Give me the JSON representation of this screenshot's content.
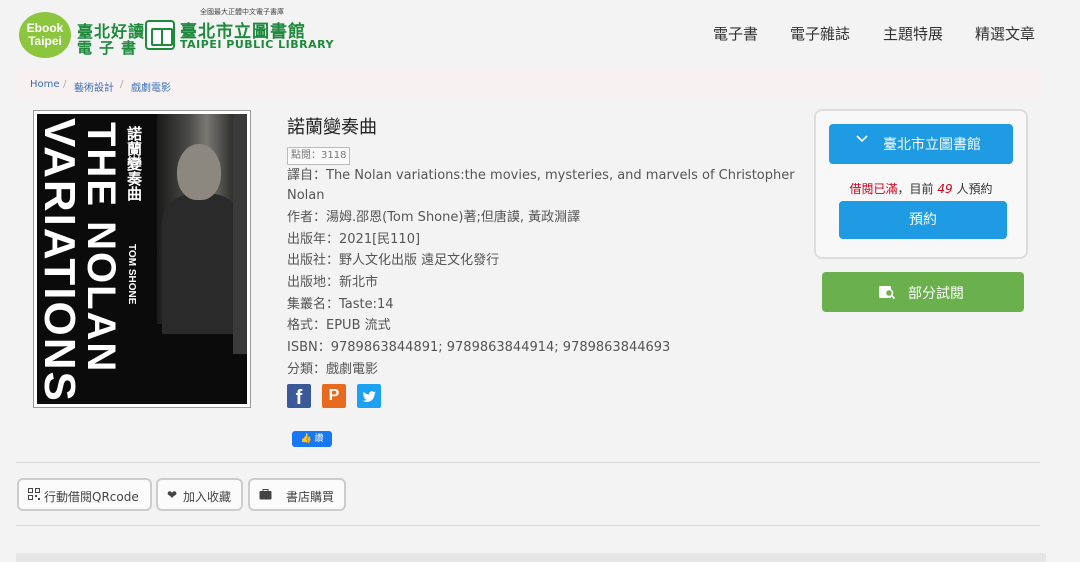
{
  "header": {
    "logo_circle": "Ebook\nTaipei",
    "logo_circle_line1": "Ebook",
    "logo_circle_line2": "Taipei",
    "tagline": "全國最大正體中文電子書庫",
    "brand_line1": "臺北好讀",
    "brand_line2": "電子書",
    "library_name": "臺北市立圖書館",
    "library_en": "TAIPEI PUBLIC LIBRARY",
    "nav": [
      "電子書",
      "電子雜誌",
      "主題特展",
      "精選文章"
    ]
  },
  "breadcrumb": [
    "Home",
    "藝術設計",
    "戲劇電影"
  ],
  "book": {
    "cover_title_a": "VARIATIONS",
    "cover_title_b": "THE NOLAN",
    "cover_title_zh": "諾蘭變奏曲",
    "cover_author": "TOM SHONE",
    "title": "諾蘭變奏曲",
    "views": "點閱：3118",
    "meta": [
      "譯自：The Nolan variations:the movies, mysteries, and marvels of Christopher",
      "Nolan",
      "作者：湯姆.邵恩(Tom Shone)著;但唐謨, 黃政淵譯",
      "出版年：2021[民110]",
      "出版社：野人文化出版 遠足文化發行",
      "出版地：新北市",
      "集叢名：Taste:14",
      "格式：EPUB 流式",
      "ISBN：9789863844891; 9789863844914; 9789863844693",
      "分類：戲劇電影"
    ],
    "like_label": "讚"
  },
  "borrow": {
    "library_button": "臺北市立圖書館",
    "status_full": "借閱已滿",
    "status_mid": "，目前",
    "waiting_count": "49",
    "status_tail": "人預約",
    "reserve_button": "預約",
    "trial_button": "部分試閱"
  },
  "actions": [
    "行動借閱QRcode",
    "加入收藏",
    "書店購買"
  ],
  "colors": {
    "primary": "#1e9be3",
    "green": "#6ab04c",
    "brand_green": "#1e8a3c",
    "alert_red": "#d0021b"
  }
}
